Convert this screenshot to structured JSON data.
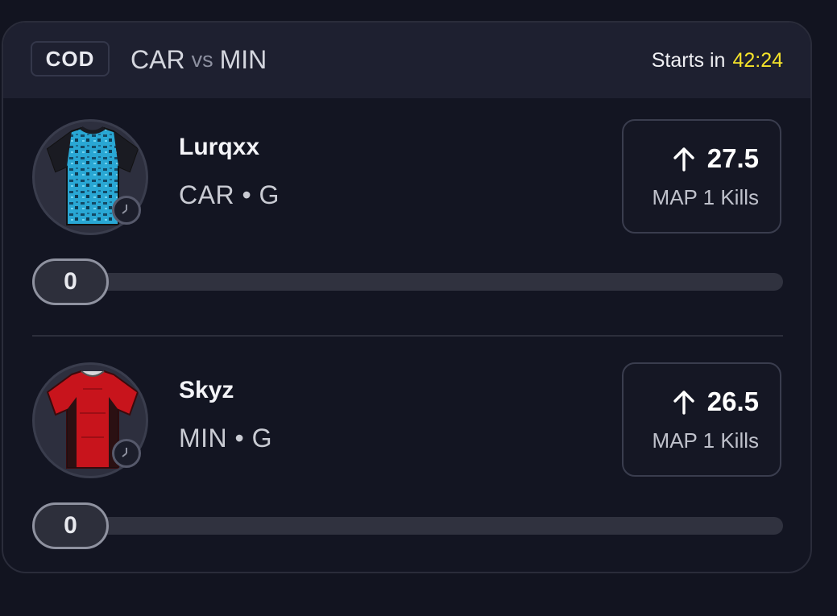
{
  "header": {
    "league": "COD",
    "team_home": "CAR",
    "vs": "vs",
    "team_away": "MIN",
    "starts_label": "Starts in",
    "countdown": "42:24"
  },
  "players": [
    {
      "name": "Lurqxx",
      "meta": "CAR • G",
      "line_value": "27.5",
      "line_label": "MAP 1 Kills",
      "direction_icon": "arrow-up-icon",
      "progress_value": "0",
      "jersey_icon": "jersey-blue-icon"
    },
    {
      "name": "Skyz",
      "meta": "MIN • G",
      "line_value": "26.5",
      "line_label": "MAP 1 Kills",
      "direction_icon": "arrow-up-icon",
      "progress_value": "0",
      "jersey_icon": "jersey-red-icon"
    }
  ],
  "colors": {
    "countdown": "#f5e32a",
    "background": "#121420",
    "header": "#1e2030"
  }
}
